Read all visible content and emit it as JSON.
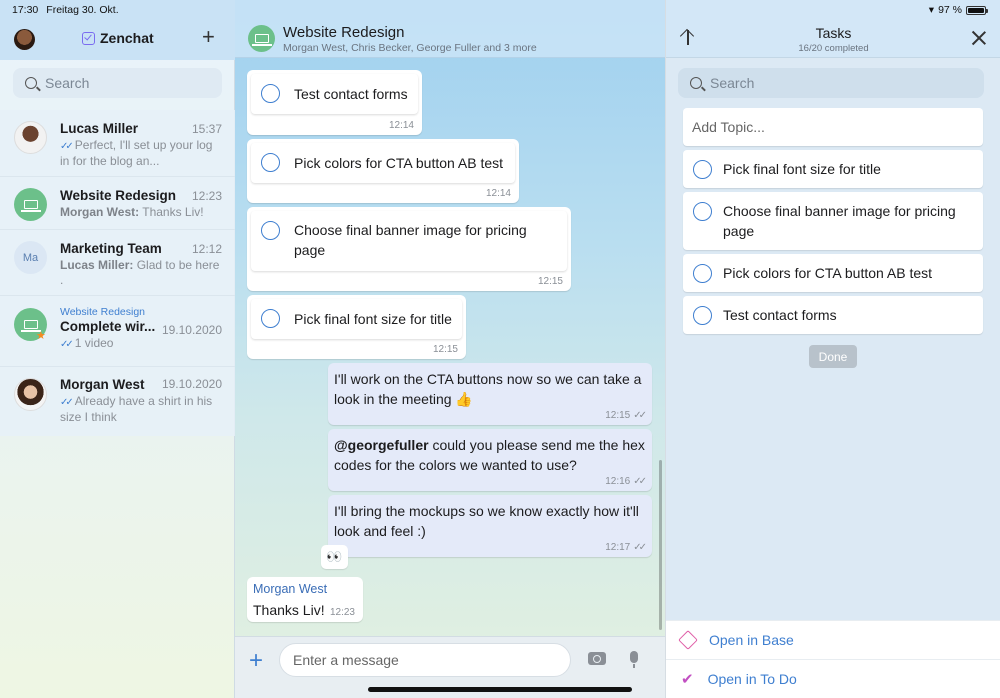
{
  "status_bar": {
    "time": "17:30",
    "date": "Freitag 30. Okt.",
    "battery": "97 %",
    "battery_level": 0.97
  },
  "sidebar": {
    "app_name": "Zenchat",
    "search_placeholder": "Search",
    "chats": [
      {
        "name": "Lucas Miller",
        "time": "15:37",
        "preview": "Perfect, I'll set up your log in for the blog an...",
        "ticks": true
      },
      {
        "name": "Website Redesign",
        "time": "12:23",
        "sender": "Morgan West:",
        "preview": "Thanks Liv!"
      },
      {
        "name": "Marketing Team",
        "time": "12:12",
        "initials": "Ma",
        "sender": "Lucas Miller:",
        "preview": "Glad to be here ."
      },
      {
        "group": "Website Redesign",
        "name": "Complete wir...",
        "time": "19.10.2020",
        "preview": "1 video",
        "ticks": true
      },
      {
        "name": "Morgan West",
        "time": "19.10.2020",
        "preview": "Already have a shirt in his size I think",
        "ticks": true
      }
    ]
  },
  "chat": {
    "title": "Website Redesign",
    "subtitle": "Morgan West, Chris Becker, George Fuller and 3 more",
    "task_messages": [
      {
        "text": "Test contact forms",
        "time": "12:14"
      },
      {
        "text": "Pick colors for CTA button AB test",
        "time": "12:14"
      },
      {
        "text": "Choose final banner image for pricing page",
        "time": "12:15"
      },
      {
        "text": "Pick final font size for title",
        "time": "12:15"
      }
    ],
    "outgoing": [
      {
        "text": "I'll work on the CTA buttons now so we can take a look in the meeting 👍",
        "time": "12:15"
      },
      {
        "mention": "@georgefuller",
        "text": " could you please send me the hex codes for the colors we wanted to use?",
        "time": "12:16"
      },
      {
        "text": "I'll bring the mockups so we know exactly how it'll look and feel  :)",
        "time": "12:17"
      }
    ],
    "reaction": "👀",
    "incoming": {
      "sender": "Morgan West",
      "text": "Thanks Liv!",
      "time": "12:23"
    },
    "composer_placeholder": "Enter a message"
  },
  "tasks": {
    "title": "Tasks",
    "subtitle": "16/20 completed",
    "search_placeholder": "Search",
    "add_topic_placeholder": "Add Topic...",
    "items": [
      "Pick final font size for title",
      "Choose final banner image for pricing page",
      "Pick colors for CTA button AB test",
      "Test contact forms"
    ],
    "done_label": "Done",
    "open_in_base": "Open in Base",
    "open_in_todo": "Open in To Do"
  },
  "colors": {
    "accent": "#3f7fd0",
    "group_avatar": "#6cc08a",
    "outgoing_bubble": "#e4eaf9"
  }
}
